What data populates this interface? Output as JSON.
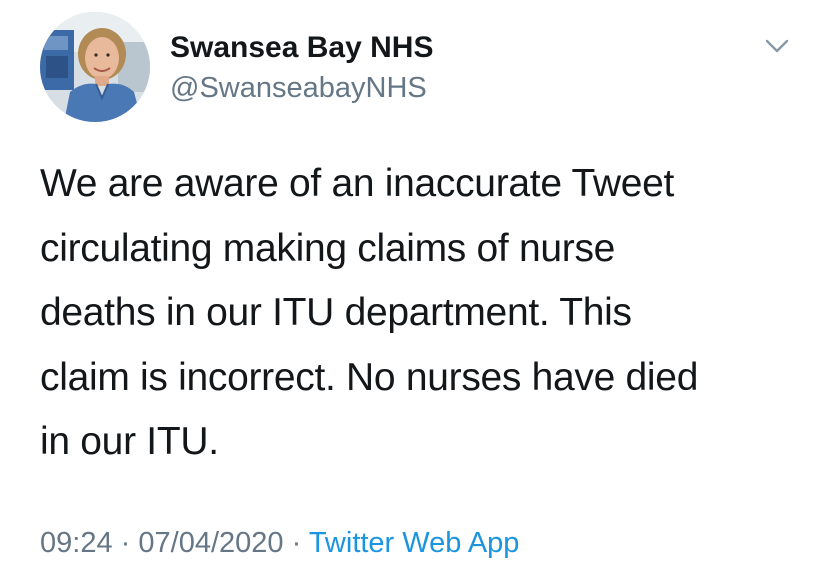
{
  "author": {
    "display_name": "Swansea Bay NHS",
    "handle": "@SwanseabayNHS"
  },
  "icons": {
    "avatar": "profile-photo-nurse",
    "menu": "chevron-down-icon"
  },
  "tweet": {
    "lines": [
      "We are aware of an inaccurate Tweet",
      "circulating making claims of nurse",
      "deaths in our ITU department. This",
      "claim is incorrect. No nurses have died",
      "in our ITU."
    ]
  },
  "meta": {
    "time": "09:24",
    "separator": "·",
    "date": "07/04/2020",
    "source": "Twitter Web App"
  },
  "colors": {
    "text": "#14171a",
    "secondary": "#657786",
    "link": "#1b95e0"
  }
}
